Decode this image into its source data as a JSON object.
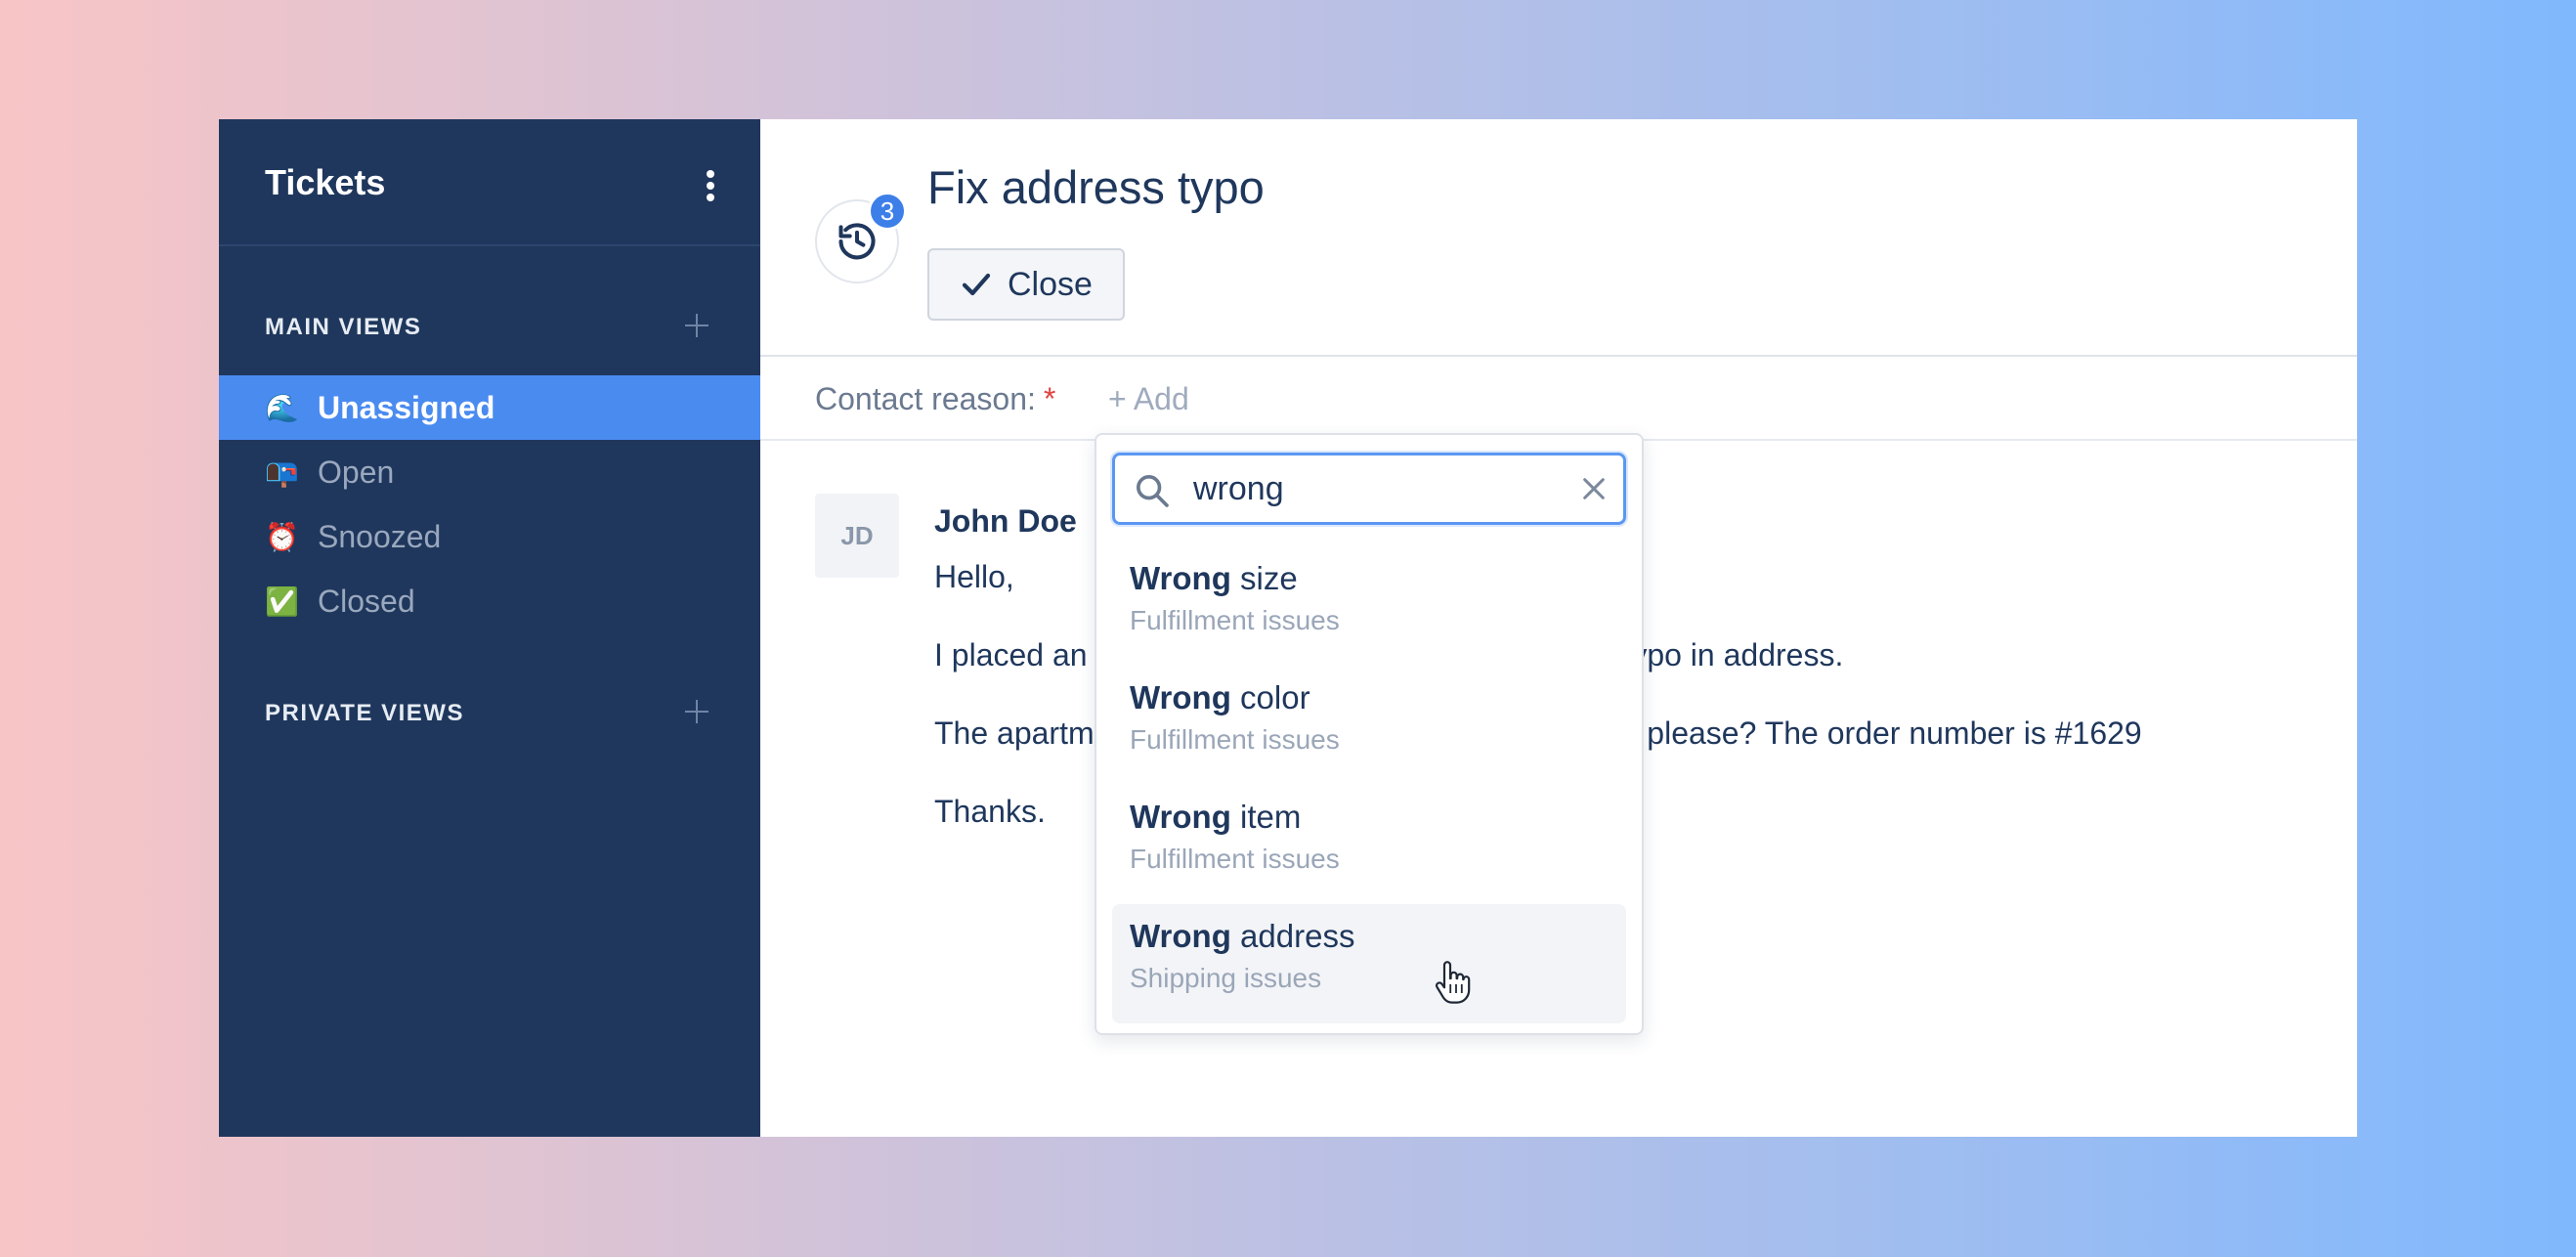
{
  "sidebar": {
    "title": "Tickets",
    "main_views_label": "MAIN VIEWS",
    "private_views_label": "PRIVATE VIEWS",
    "items": [
      {
        "emoji": "🌊",
        "label": "Unassigned"
      },
      {
        "emoji": "📭",
        "label": "Open"
      },
      {
        "emoji": "⏰",
        "label": "Snoozed"
      },
      {
        "emoji": "✅",
        "label": "Closed"
      }
    ]
  },
  "ticket": {
    "title": "Fix address typo",
    "history_count": "3",
    "close_label": "Close",
    "contact_reason_label": "Contact reason:",
    "required_mark": "*",
    "add_label": "+ Add"
  },
  "message": {
    "avatar_initials": "JD",
    "author": "John Doe",
    "lines": [
      "Hello,",
      "I placed an order and I just realised that I made a typo in address.",
      "The apartment number should be 12. Can you fix it please? The order number is #1629",
      "Thanks."
    ]
  },
  "dropdown": {
    "search_value": "wrong",
    "options": [
      {
        "match": "Wrong",
        "rest": " size",
        "category": "Fulfillment issues"
      },
      {
        "match": "Wrong",
        "rest": " color",
        "category": "Fulfillment issues"
      },
      {
        "match": "Wrong",
        "rest": " item",
        "category": "Fulfillment issues"
      },
      {
        "match": "Wrong",
        "rest": " address",
        "category": "Shipping issues"
      }
    ]
  },
  "colors": {
    "sidebar_bg": "#1f375c",
    "active_item": "#4a8bf0",
    "badge": "#3d7fe8",
    "required": "#e0433f"
  }
}
